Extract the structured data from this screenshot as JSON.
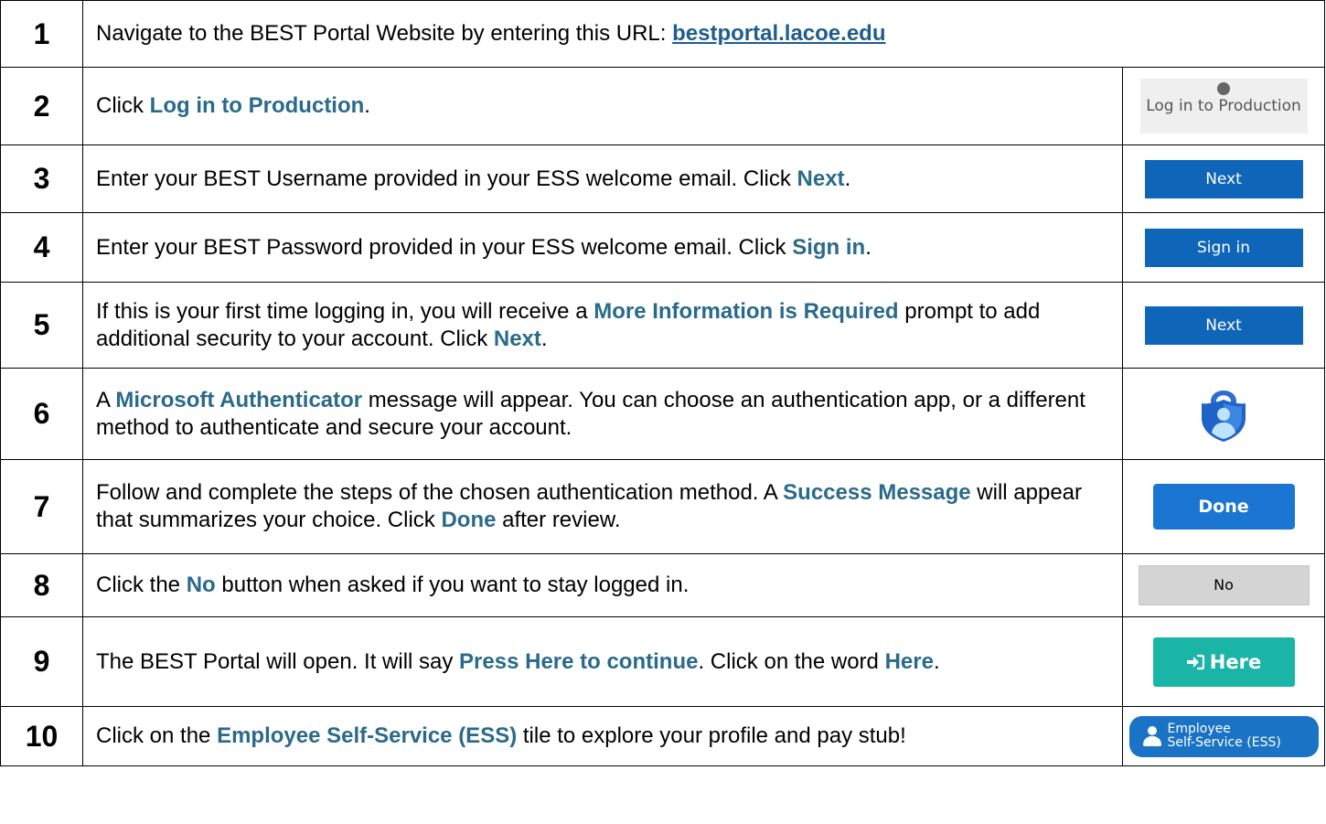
{
  "steps": [
    {
      "num": "1",
      "parts": [
        "Navigate to the BEST Portal Website by entering this URL: "
      ],
      "link": "bestportal.lacoe.edu"
    },
    {
      "num": "2",
      "parts": [
        "Click ",
        "Log in to Production",
        "."
      ],
      "visual": "Log in to Production"
    },
    {
      "num": "3",
      "parts": [
        "Enter your BEST Username provided in your ESS welcome email. Click ",
        "Next",
        "."
      ],
      "visual": "Next"
    },
    {
      "num": "4",
      "parts": [
        "Enter your BEST Password provided in your ESS welcome email. Click ",
        "Sign in",
        "."
      ],
      "visual": "Sign in"
    },
    {
      "num": "5",
      "parts": [
        "If this is your first time logging in, you will receive a ",
        "More Information is Required",
        " prompt to add additional security to your account. Click ",
        "Next",
        "."
      ],
      "visual": "Next"
    },
    {
      "num": "6",
      "parts": [
        "A ",
        "Microsoft Authenticator",
        " message will appear. You can choose an authentication app, or a different method to authenticate and secure your account."
      ]
    },
    {
      "num": "7",
      "parts": [
        "Follow and complete the steps of the chosen authentication method. A ",
        "Success Message",
        " will appear that summarizes your choice. Click ",
        "Done",
        " after review."
      ],
      "visual": "Done"
    },
    {
      "num": "8",
      "parts": [
        "Click the ",
        "No",
        " button when asked if you want to stay logged in."
      ],
      "visual": "No"
    },
    {
      "num": "9",
      "parts": [
        "The BEST Portal will open. It will say ",
        "Press Here to continue",
        ". Click on the word ",
        "Here",
        "."
      ],
      "visual": "Here"
    },
    {
      "num": "10",
      "parts": [
        "Click on the ",
        "Employee Self-Service (ESS)",
        " tile to explore your profile and pay stub!"
      ],
      "visual_line1": "Employee",
      "visual_line2": "Self-Service (ESS)"
    }
  ],
  "colors": {
    "highlight": "#2a6a8a",
    "button_blue": "#0f65b8",
    "done_blue": "#1a76d2",
    "here_teal": "#1bb5a8",
    "no_gray": "#d4d4d4"
  },
  "icons": [
    "globe-icon",
    "microsoft-authenticator-icon",
    "sign-in-arrow-icon",
    "person-icon"
  ]
}
